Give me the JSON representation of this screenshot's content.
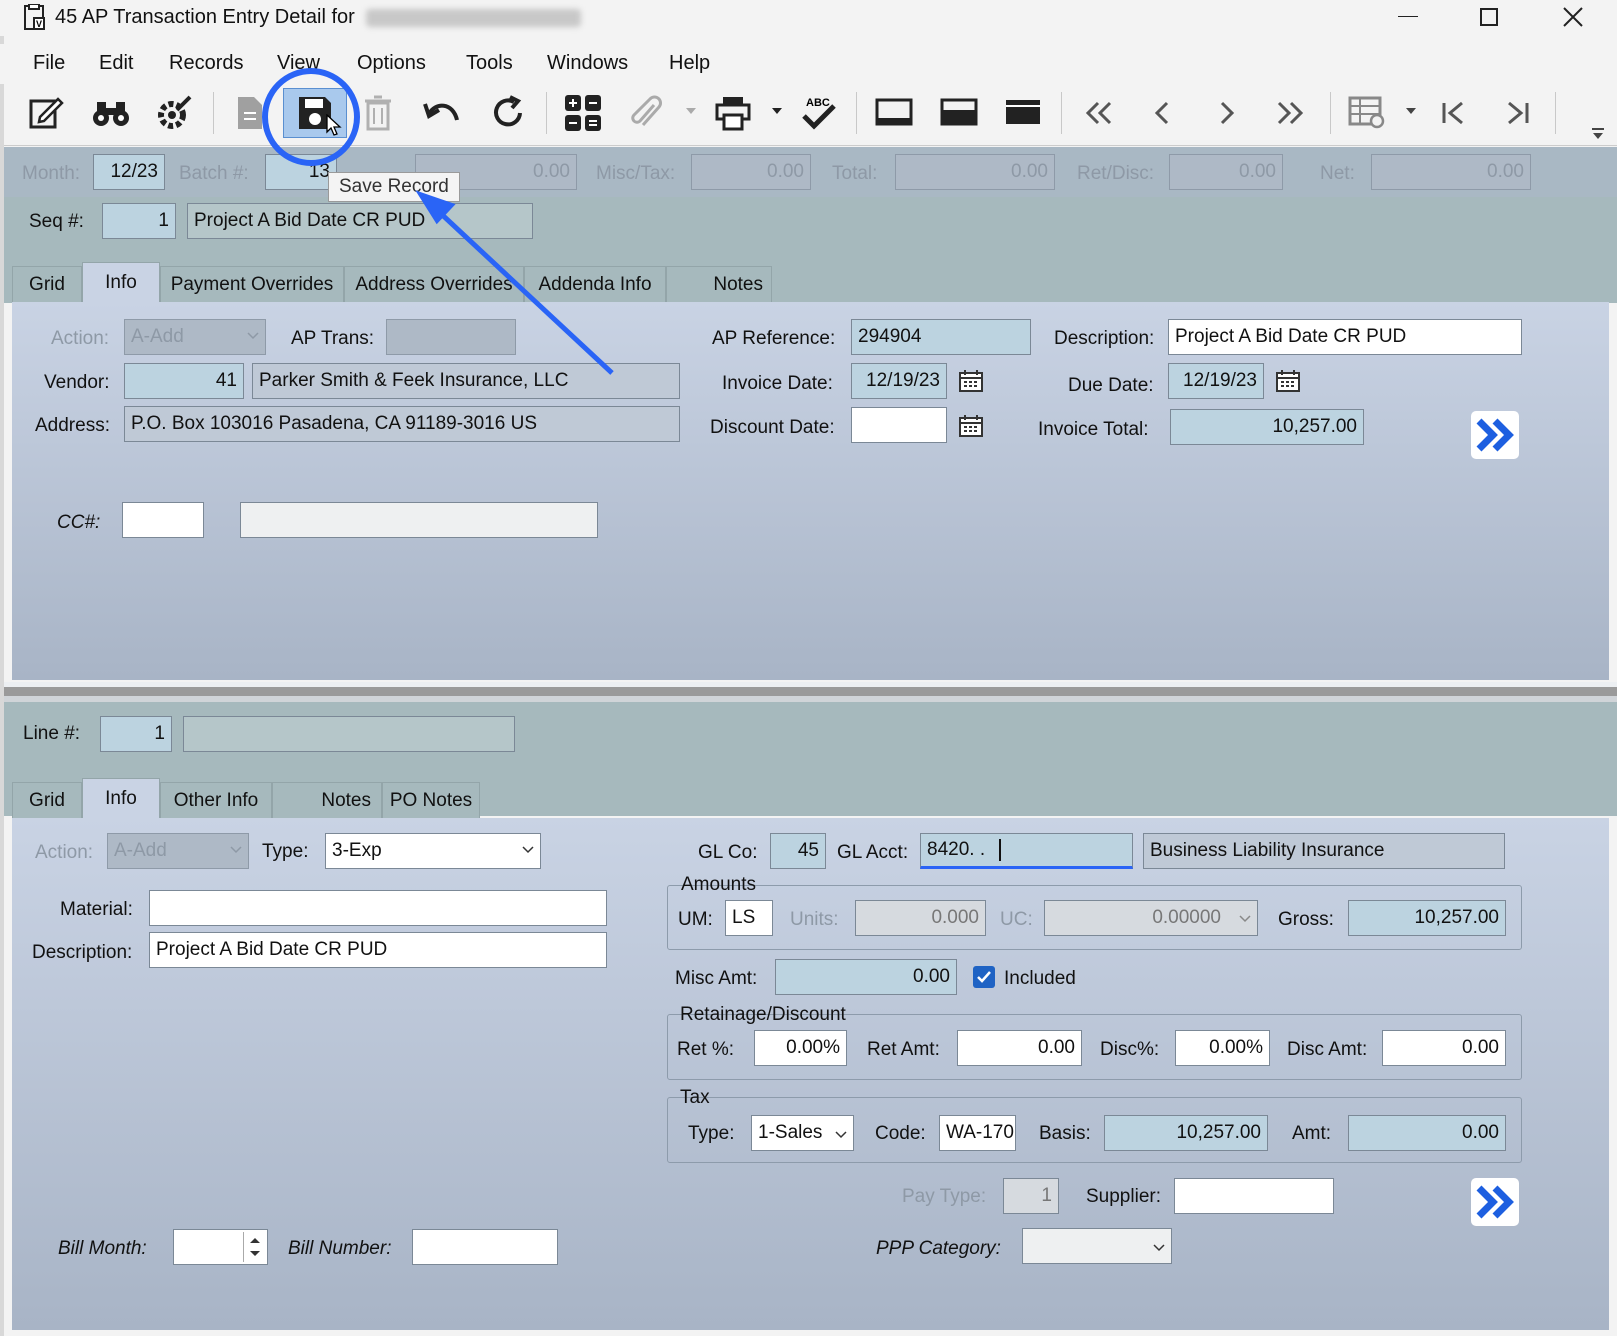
{
  "title": {
    "text": "45 AP Transaction Entry Detail for"
  },
  "menu": [
    "File",
    "Edit",
    "Records",
    "View",
    "Options",
    "Tools",
    "Windows",
    "Help"
  ],
  "tooltip": "Save Record",
  "header": {
    "month_label": "Month:",
    "month": "12/23",
    "batch_label": "Batch #:",
    "batch": "13",
    "amount": "0.00",
    "misctax_label": "Misc/Tax:",
    "misctax": "0.00",
    "total_label": "Total:",
    "total": "0.00",
    "retdisc_label": "Ret/Disc:",
    "retdisc": "0.00",
    "net_label": "Net:",
    "net": "0.00"
  },
  "seq": {
    "label": "Seq #:",
    "value": "1",
    "desc": "Project A Bid Date CR PUD"
  },
  "top_tabs": [
    "Grid",
    "Info",
    "Payment Overrides",
    "Address Overrides",
    "Addenda Info",
    "Notes"
  ],
  "info": {
    "action_label": "Action:",
    "action": "A-Add",
    "aptrans_label": "AP Trans:",
    "aptrans": "",
    "apref_label": "AP Reference:",
    "apref": "294904",
    "desc_label": "Description:",
    "desc": "Project A Bid Date CR PUD",
    "vendor_label": "Vendor:",
    "vendor": "41",
    "vendor_name": "Parker Smith & Feek Insurance, LLC",
    "invdate_label": "Invoice Date:",
    "invdate": "12/19/23",
    "duedate_label": "Due Date:",
    "duedate": "12/19/23",
    "address_label": "Address:",
    "address": "P.O. Box 103016  Pasadena, CA  91189-3016  US",
    "discdate_label": "Discount Date:",
    "discdate": "",
    "invtotal_label": "Invoice Total:",
    "invtotal": "10,257.00",
    "cc_label": "CC#:"
  },
  "line": {
    "label": "Line #:",
    "value": "1"
  },
  "bottom_tabs": [
    "Grid",
    "Info",
    "Other Info",
    "Notes",
    "PO Notes"
  ],
  "line_info": {
    "action_label": "Action:",
    "action": "A-Add",
    "type_label": "Type:",
    "type": "3-Exp",
    "material_label": "Material:",
    "material": "",
    "desc_label": "Description:",
    "desc": "Project A Bid Date CR PUD",
    "glco_label": "GL Co:",
    "glco": "45",
    "glacct_label": "GL Acct:",
    "glacct": "8420.  .",
    "glacct_desc": "Business Liability Insurance",
    "amounts_title": "Amounts",
    "um_label": "UM:",
    "um": "LS",
    "units_label": "Units:",
    "units": "0.000",
    "uc_label": "UC:",
    "uc": "0.00000",
    "gross_label": "Gross:",
    "gross": "10,257.00",
    "miscamt_label": "Misc Amt:",
    "miscamt": "0.00",
    "included_label": "Included",
    "ret_title": "Retainage/Discount",
    "retpct_label": "Ret %:",
    "retpct": "0.00%",
    "retamt_label": "Ret Amt:",
    "retamt": "0.00",
    "discpct_label": "Disc%:",
    "discpct": "0.00%",
    "discamt_label": "Disc Amt:",
    "discamt": "0.00",
    "tax_title": "Tax",
    "taxtype_label": "Type:",
    "taxtype": "1-Sales",
    "code_label": "Code:",
    "code": "WA-170",
    "basis_label": "Basis:",
    "basis": "10,257.00",
    "amt_label": "Amt:",
    "amt": "0.00",
    "paytype_label": "Pay Type:",
    "paytype": "1",
    "supplier_label": "Supplier:",
    "supplier": "",
    "ppp_label": "PPP Category:",
    "billmonth_label": "Bill Month:",
    "billnum_label": "Bill Number:"
  },
  "colors": {
    "accent": "#2a64f6",
    "panel": "#b8c3d6",
    "teal": "#a6b9bd",
    "field_ro": "#bcd3e0"
  }
}
